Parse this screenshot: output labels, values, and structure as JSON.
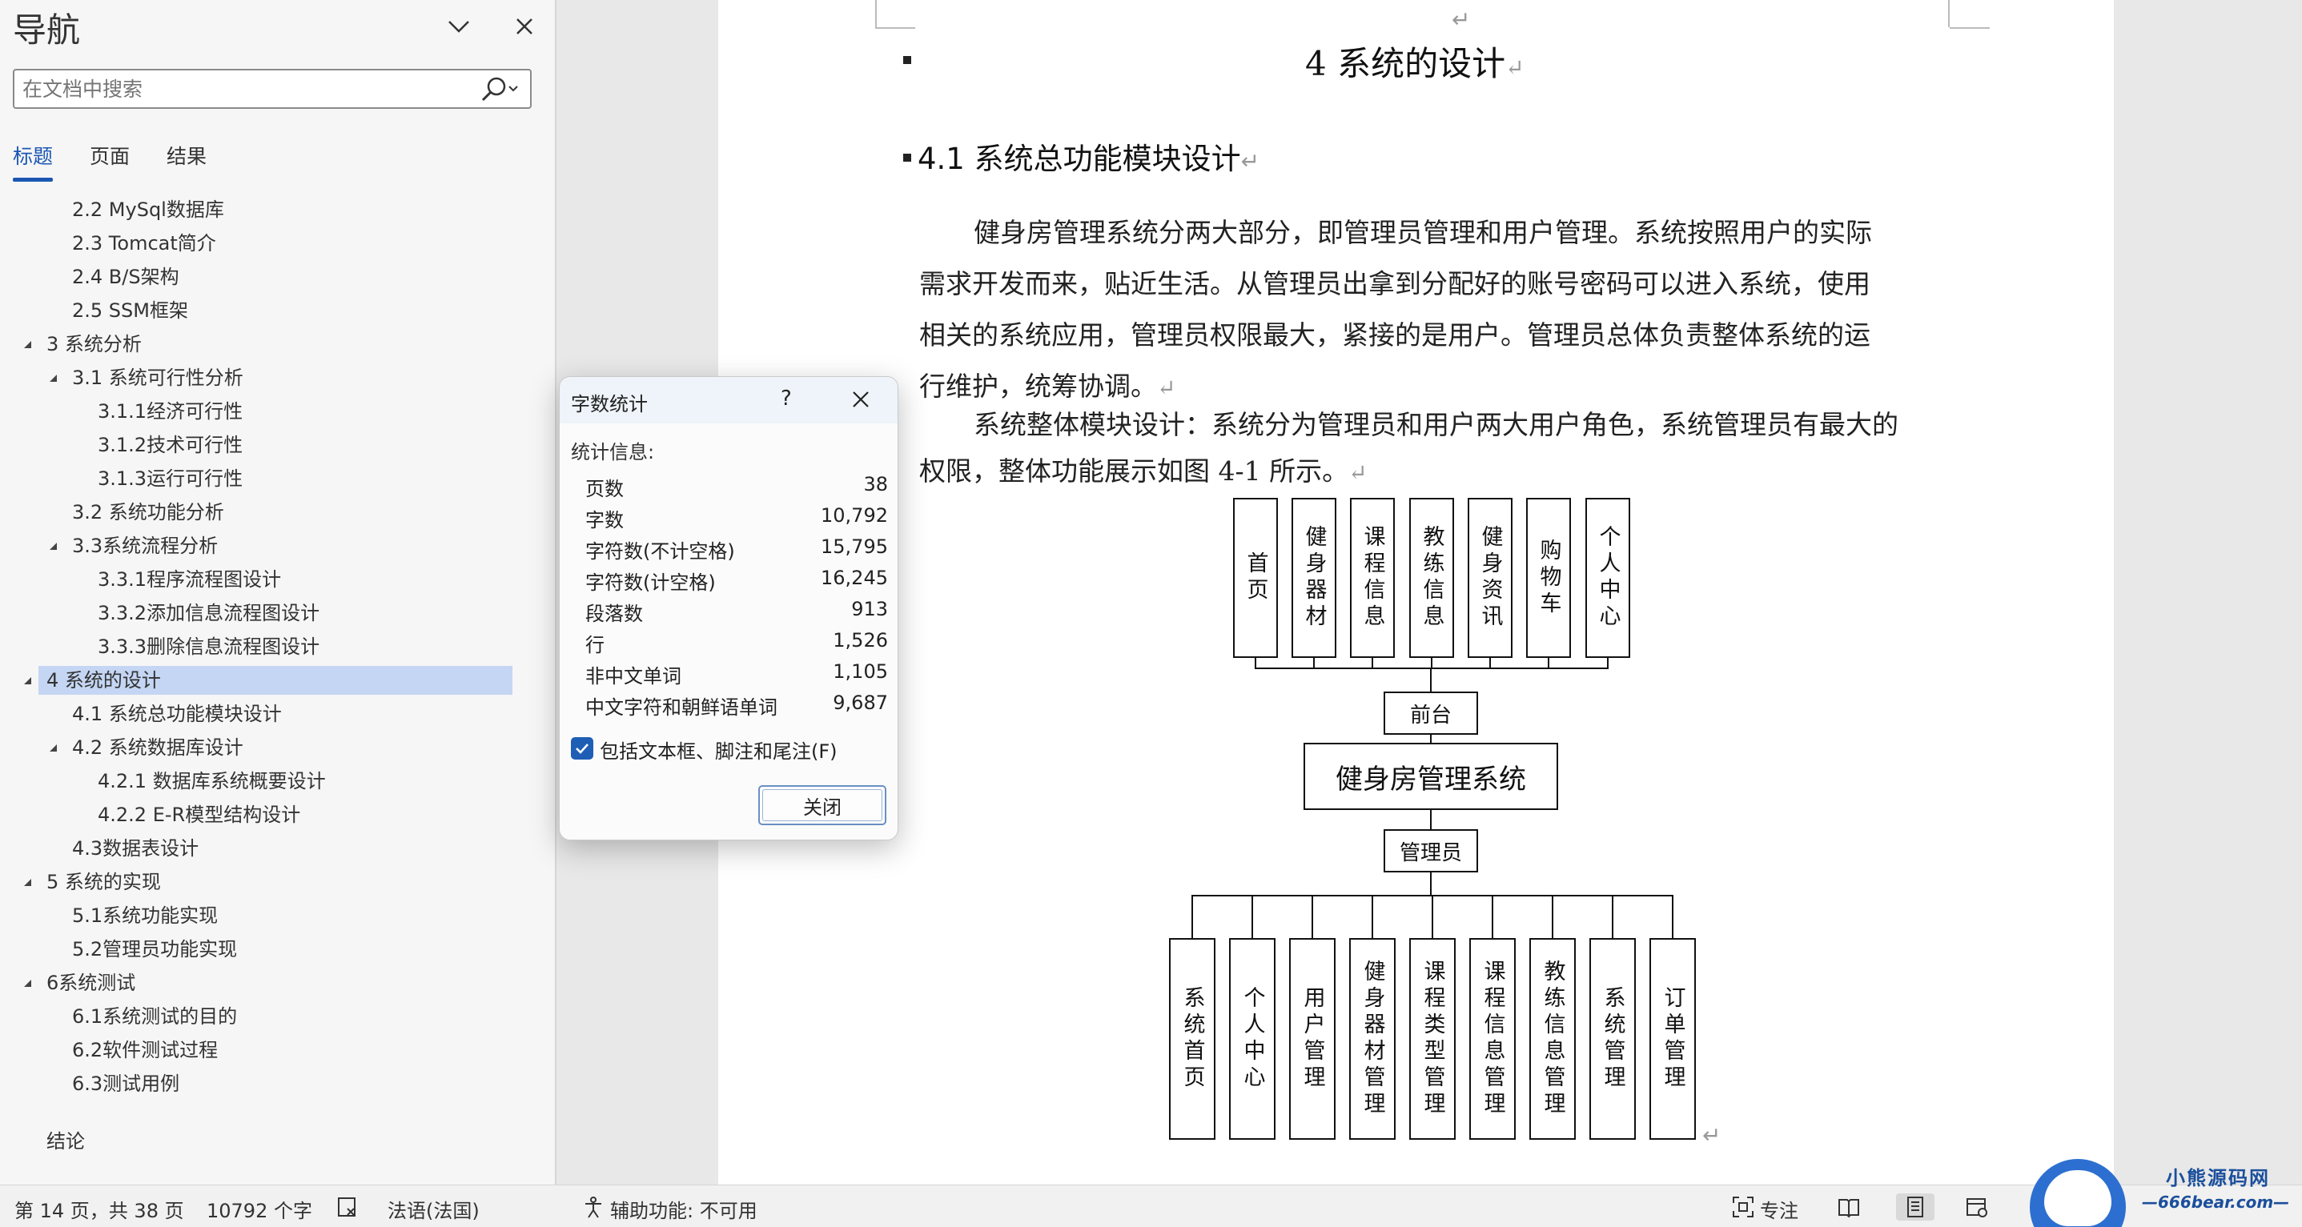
{
  "nav": {
    "title": "导航",
    "search_placeholder": "在文档中搜索",
    "tabs": [
      {
        "label": "标题",
        "active": true
      },
      {
        "label": "页面",
        "active": false
      },
      {
        "label": "结果",
        "active": false
      }
    ],
    "items": [
      {
        "label": "2.2 MySql数据库",
        "level": 2,
        "toggle": false,
        "selected": false
      },
      {
        "label": "2.3 Tomcat简介",
        "level": 2,
        "toggle": false,
        "selected": false
      },
      {
        "label": "2.4 B/S架构",
        "level": 2,
        "toggle": false,
        "selected": false
      },
      {
        "label": "2.5 SSM框架",
        "level": 2,
        "toggle": false,
        "selected": false
      },
      {
        "label": "3   系统分析",
        "level": 1,
        "toggle": true,
        "selected": false
      },
      {
        "label": "3.1 系统可行性分析",
        "level": 2,
        "toggle": true,
        "selected": false
      },
      {
        "label": "3.1.1经济可行性",
        "level": 3,
        "toggle": false,
        "selected": false
      },
      {
        "label": "3.1.2技术可行性",
        "level": 3,
        "toggle": false,
        "selected": false
      },
      {
        "label": "3.1.3运行可行性",
        "level": 3,
        "toggle": false,
        "selected": false
      },
      {
        "label": "3.2 系统功能分析",
        "level": 2,
        "toggle": false,
        "selected": false
      },
      {
        "label": "3.3系统流程分析",
        "level": 2,
        "toggle": true,
        "selected": false
      },
      {
        "label": "3.3.1程序流程图设计",
        "level": 3,
        "toggle": false,
        "selected": false
      },
      {
        "label": "3.3.2添加信息流程图设计",
        "level": 3,
        "toggle": false,
        "selected": false
      },
      {
        "label": "3.3.3删除信息流程图设计",
        "level": 3,
        "toggle": false,
        "selected": false
      },
      {
        "label": "4  系统的设计",
        "level": 1,
        "toggle": true,
        "selected": true
      },
      {
        "label": "4.1 系统总功能模块设计",
        "level": 2,
        "toggle": false,
        "selected": false
      },
      {
        "label": "4.2 系统数据库设计",
        "level": 2,
        "toggle": true,
        "selected": false
      },
      {
        "label": "4.2.1 数据库系统概要设计",
        "level": 3,
        "toggle": false,
        "selected": false
      },
      {
        "label": "4.2.2 E-R模型结构设计",
        "level": 3,
        "toggle": false,
        "selected": false
      },
      {
        "label": "4.3数据表设计",
        "level": 2,
        "toggle": false,
        "selected": false
      },
      {
        "label": "5   系统的实现",
        "level": 1,
        "toggle": true,
        "selected": false
      },
      {
        "label": "5.1系统功能实现",
        "level": 2,
        "toggle": false,
        "selected": false
      },
      {
        "label": "5.2管理员功能实现",
        "level": 2,
        "toggle": false,
        "selected": false
      },
      {
        "label": "6系统测试",
        "level": 1,
        "toggle": true,
        "selected": false
      },
      {
        "label": "6.1系统测试的目的",
        "level": 2,
        "toggle": false,
        "selected": false
      },
      {
        "label": "6.2软件测试过程",
        "level": 2,
        "toggle": false,
        "selected": false
      },
      {
        "label": "6.3测试用例",
        "level": 2,
        "toggle": false,
        "selected": false
      },
      {
        "label": "结论",
        "level": 1,
        "toggle": false,
        "selected": false
      }
    ]
  },
  "document": {
    "heading1": "4    系统的设计",
    "heading2": "4.1  系统总功能模块设计",
    "para1_lines": [
      "健身房管理系统分两大部分，即管理员管理和用户管理。系统按照用户的实际",
      "需求开发而来，贴近生活。从管理员出拿到分配好的账号密码可以进入系统，使用",
      "相关的系统应用，管理员权限最大，紧接的是用户。管理员总体负责整体系统的运",
      "行维护，统筹协调。"
    ],
    "para2_lines": [
      "系统整体模块设计：系统分为管理员和用户两大用户角色，系统管理员有最大的",
      "权限，整体功能展示如图 4-1 所示。"
    ],
    "pilcrow": "↵",
    "diagram": {
      "top_modules": [
        "首页",
        "健身器材",
        "课程信息",
        "教练信息",
        "健身资讯",
        "购物车",
        "个人中心"
      ],
      "front_label": "前台",
      "system_label": "健身房管理系统",
      "admin_label": "管理员",
      "bottom_modules": [
        "系统首页",
        "个人中心",
        "用户管理",
        "健身器材管理",
        "课程类型管理",
        "课程信息管理",
        "教练信息管理",
        "系统管理",
        "订单管理"
      ]
    }
  },
  "dialog": {
    "title": "字数统计",
    "help": "?",
    "subtitle": "统计信息:",
    "stats": [
      {
        "label": "页数",
        "value": "38"
      },
      {
        "label": "字数",
        "value": "10,792"
      },
      {
        "label": "字符数(不计空格)",
        "value": "15,795"
      },
      {
        "label": "字符数(计空格)",
        "value": "16,245"
      },
      {
        "label": "段落数",
        "value": "913"
      },
      {
        "label": "行",
        "value": "1,526"
      },
      {
        "label": "非中文单词",
        "value": "1,105"
      },
      {
        "label": "中文字符和朝鲜语单词",
        "value": "9,687"
      }
    ],
    "checkbox_label": "包括文本框、脚注和尾注(F)",
    "checkbox_checked": true,
    "close_label": "关闭"
  },
  "status": {
    "page_info": "第 14 页，共 38 页",
    "word_count": "10792 个字",
    "language": "法语(法国)",
    "accessibility": "辅助功能: 不可用",
    "focus": "专注"
  },
  "watermark": {
    "line1": "小熊源码网",
    "line2": "—666bear.com—"
  },
  "colors": {
    "accent": "#1b57b2",
    "selection": "#c4d6f3",
    "checkbox": "#1f5eb5"
  }
}
